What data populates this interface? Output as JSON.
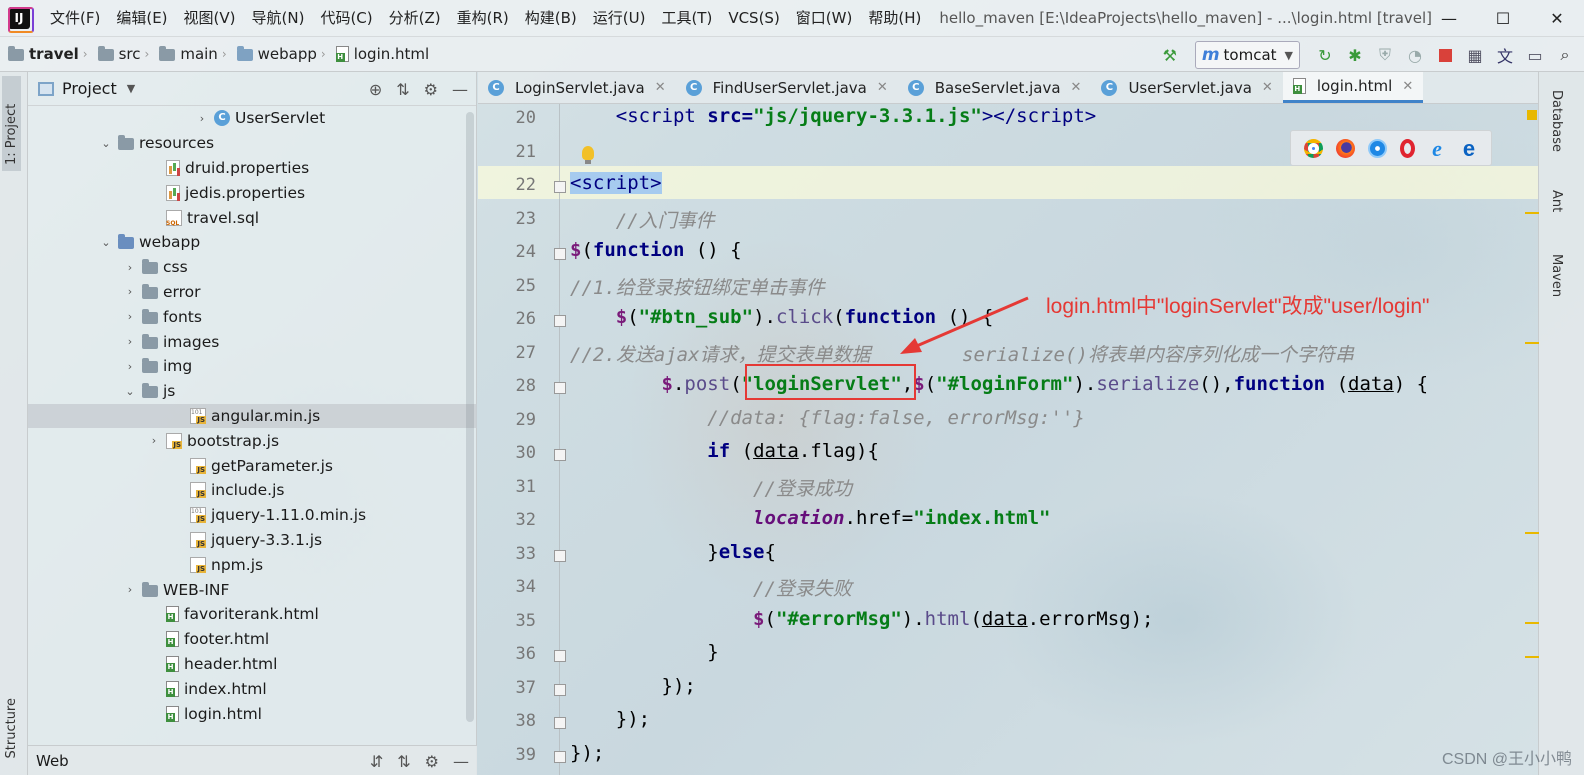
{
  "menubar": {
    "logo": "IJ",
    "items": [
      "文件(F)",
      "编辑(E)",
      "视图(V)",
      "导航(N)",
      "代码(C)",
      "分析(Z)",
      "重构(R)",
      "构建(B)",
      "运行(U)",
      "工具(T)",
      "VCS(S)",
      "窗口(W)",
      "帮助(H)"
    ],
    "window_title": "hello_maven [E:\\IdeaProjects\\hello_maven] - ...\\login.html [travel]"
  },
  "window_controls": {
    "minimize": "—",
    "maximize": "☐",
    "close": "✕"
  },
  "breadcrumb": [
    "travel",
    "src",
    "main",
    "webapp",
    "login.html"
  ],
  "run_config": {
    "name": "tomcat"
  },
  "left_strip": {
    "project_tab": "1: Project",
    "structure_tab": "Structure"
  },
  "project_panel": {
    "title": "Project",
    "footer": "Web"
  },
  "tree": [
    {
      "label": "UserServlet",
      "type": "class",
      "indent": 7,
      "arrow": "›"
    },
    {
      "label": "resources",
      "type": "folder",
      "indent": 3,
      "arrow": "⌄"
    },
    {
      "label": "druid.properties",
      "type": "props",
      "indent": 5,
      "arrow": ""
    },
    {
      "label": "jedis.properties",
      "type": "props",
      "indent": 5,
      "arrow": ""
    },
    {
      "label": "travel.sql",
      "type": "sql",
      "indent": 5,
      "arrow": ""
    },
    {
      "label": "webapp",
      "type": "folder-web",
      "indent": 3,
      "arrow": "⌄"
    },
    {
      "label": "css",
      "type": "folder",
      "indent": 4,
      "arrow": "›"
    },
    {
      "label": "error",
      "type": "folder",
      "indent": 4,
      "arrow": "›"
    },
    {
      "label": "fonts",
      "type": "folder",
      "indent": 4,
      "arrow": "›"
    },
    {
      "label": "images",
      "type": "folder",
      "indent": 4,
      "arrow": "›"
    },
    {
      "label": "img",
      "type": "folder",
      "indent": 4,
      "arrow": "›"
    },
    {
      "label": "js",
      "type": "folder",
      "indent": 4,
      "arrow": "⌄"
    },
    {
      "label": "angular.min.js",
      "type": "jsmin",
      "indent": 6,
      "arrow": "",
      "selected": true
    },
    {
      "label": "bootstrap.js",
      "type": "js",
      "indent": 5,
      "arrow": "›"
    },
    {
      "label": "getParameter.js",
      "type": "js",
      "indent": 6,
      "arrow": ""
    },
    {
      "label": "include.js",
      "type": "js",
      "indent": 6,
      "arrow": ""
    },
    {
      "label": "jquery-1.11.0.min.js",
      "type": "jsmin",
      "indent": 6,
      "arrow": ""
    },
    {
      "label": "jquery-3.3.1.js",
      "type": "js",
      "indent": 6,
      "arrow": ""
    },
    {
      "label": "npm.js",
      "type": "js",
      "indent": 6,
      "arrow": ""
    },
    {
      "label": "WEB-INF",
      "type": "folder",
      "indent": 4,
      "arrow": "›"
    },
    {
      "label": "favoriterank.html",
      "type": "html",
      "indent": 5,
      "arrow": ""
    },
    {
      "label": "footer.html",
      "type": "html",
      "indent": 5,
      "arrow": ""
    },
    {
      "label": "header.html",
      "type": "html",
      "indent": 5,
      "arrow": ""
    },
    {
      "label": "index.html",
      "type": "html",
      "indent": 5,
      "arrow": ""
    },
    {
      "label": "login.html",
      "type": "html",
      "indent": 5,
      "arrow": ""
    }
  ],
  "tabs": [
    {
      "label": "LoginServlet.java",
      "icon": "class",
      "active": false
    },
    {
      "label": "FindUserServlet.java",
      "icon": "class",
      "active": false
    },
    {
      "label": "BaseServlet.java",
      "icon": "class",
      "active": false
    },
    {
      "label": "UserServlet.java",
      "icon": "class",
      "active": false
    },
    {
      "label": "login.html",
      "icon": "html",
      "active": true
    }
  ],
  "editor": {
    "lines": [
      {
        "n": "20",
        "html": "    <span class='tag'>&lt;script</span> <span class='tag' style='font-weight:bold'>src=</span><span class='str'>\"js/jquery-3.3.1.js\"</span><span class='tag'>&gt;&lt;/script&gt;</span>"
      },
      {
        "n": "21",
        "html": ""
      },
      {
        "n": "22",
        "html": "<span class='tag sel-script'>&lt;script&gt;</span>"
      },
      {
        "n": "23",
        "html": "    <span class='cmt'>//入门事件</span>"
      },
      {
        "n": "24",
        "html": "<span class='dollar'>$</span>(<span class='kw'>function</span> () {"
      },
      {
        "n": "25",
        "html": "<span class='cmt'>//1.给登录按钮绑定单击事件</span>"
      },
      {
        "n": "26",
        "html": "    <span class='dollar'>$</span>(<span class='str'>\"#btn_sub\"</span>).<span class='fn'>click</span>(<span class='kw'>function</span> () {"
      },
      {
        "n": "27",
        "html": "<span class='cmt'>//2.发送ajax请求，提交表单数据        serialize()将表单内容序列化成一个字符串</span>"
      },
      {
        "n": "28",
        "html": "        <span class='dollar'>$</span>.<span class='fn'>post</span>(<span class='str'>\"loginServlet\"</span>,<span class='dollar'>$</span>(<span class='str'>\"#loginForm\"</span>).<span class='fn'>serialize</span>(),<span class='kw'>function</span> (<span class='ul'>data</span>) {"
      },
      {
        "n": "29",
        "html": "            <span class='cmt'>//data: {flag:false, errorMsg:''}</span>"
      },
      {
        "n": "30",
        "html": "            <span class='kw'>if</span> (<span class='ul'>data</span>.flag){"
      },
      {
        "n": "31",
        "html": "                <span class='cmt'>//登录成功</span>"
      },
      {
        "n": "32",
        "html": "                <span class='loc'>location</span>.href=<span class='str'>\"index.html\"</span>"
      },
      {
        "n": "33",
        "html": "            }<span class='kw'>else</span>{"
      },
      {
        "n": "34",
        "html": "                <span class='cmt'>//登录失败</span>"
      },
      {
        "n": "35",
        "html": "                <span class='dollar'>$</span>(<span class='str'>\"#errorMsg\"</span>).<span class='fn'>html</span>(<span class='ul'>data</span>.errorMsg);"
      },
      {
        "n": "36",
        "html": "            }"
      },
      {
        "n": "37",
        "html": "        });"
      },
      {
        "n": "38",
        "html": "    });"
      },
      {
        "n": "39",
        "html": "});"
      }
    ]
  },
  "annotation": {
    "text": "login.html中\"loginServlet\"改成\"user/login\""
  },
  "right_strip": {
    "tabs": [
      "Database",
      "Ant",
      "Maven"
    ]
  },
  "watermark": "CSDN @王小小鸭",
  "colors": {
    "accent": "#4083c9",
    "annotation": "#e53935",
    "string": "#067d17",
    "keyword": "#000080"
  }
}
